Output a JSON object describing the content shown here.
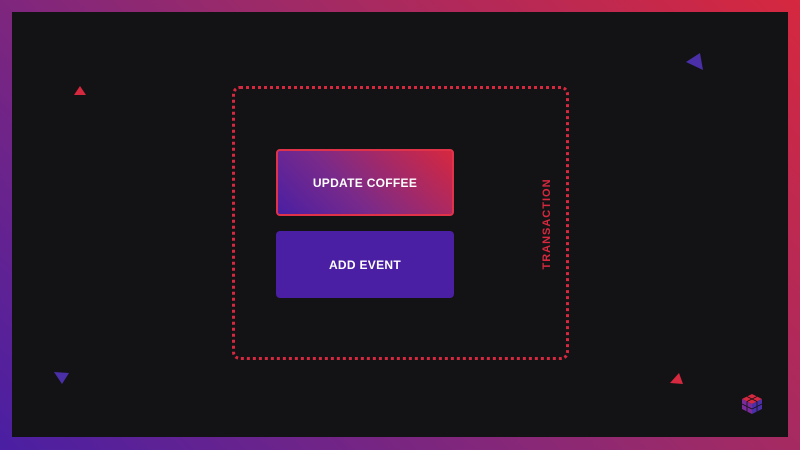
{
  "diagram": {
    "buttons": {
      "update_coffee": "UPDATE COFFEE",
      "add_event": "ADD EVENT"
    },
    "transaction_label": "TRANSACTION",
    "icons": [
      "triangle-decoration-icon",
      "cube-logo-icon"
    ]
  },
  "colors": {
    "accent_red": "#d6283f",
    "accent_purple": "#4a1fa3",
    "background": "#131315"
  }
}
